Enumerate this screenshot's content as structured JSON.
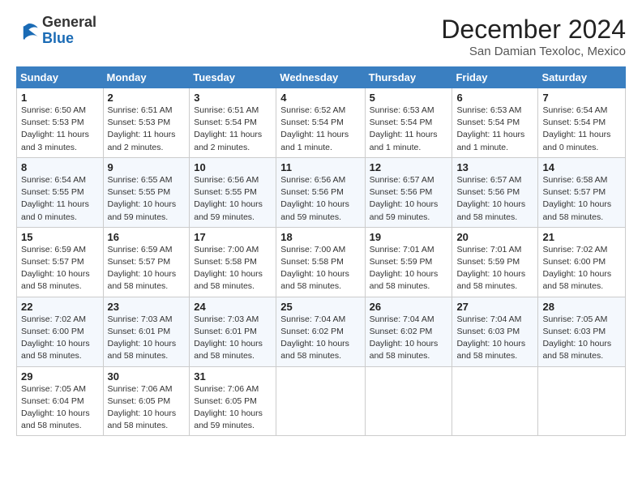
{
  "logo": {
    "general": "General",
    "blue": "Blue"
  },
  "title": "December 2024",
  "subtitle": "San Damian Texoloc, Mexico",
  "days_of_week": [
    "Sunday",
    "Monday",
    "Tuesday",
    "Wednesday",
    "Thursday",
    "Friday",
    "Saturday"
  ],
  "weeks": [
    [
      {
        "day": "1",
        "detail": "Sunrise: 6:50 AM\nSunset: 5:53 PM\nDaylight: 11 hours\nand 3 minutes."
      },
      {
        "day": "2",
        "detail": "Sunrise: 6:51 AM\nSunset: 5:53 PM\nDaylight: 11 hours\nand 2 minutes."
      },
      {
        "day": "3",
        "detail": "Sunrise: 6:51 AM\nSunset: 5:54 PM\nDaylight: 11 hours\nand 2 minutes."
      },
      {
        "day": "4",
        "detail": "Sunrise: 6:52 AM\nSunset: 5:54 PM\nDaylight: 11 hours\nand 1 minute."
      },
      {
        "day": "5",
        "detail": "Sunrise: 6:53 AM\nSunset: 5:54 PM\nDaylight: 11 hours\nand 1 minute."
      },
      {
        "day": "6",
        "detail": "Sunrise: 6:53 AM\nSunset: 5:54 PM\nDaylight: 11 hours\nand 1 minute."
      },
      {
        "day": "7",
        "detail": "Sunrise: 6:54 AM\nSunset: 5:54 PM\nDaylight: 11 hours\nand 0 minutes."
      }
    ],
    [
      {
        "day": "8",
        "detail": "Sunrise: 6:54 AM\nSunset: 5:55 PM\nDaylight: 11 hours\nand 0 minutes."
      },
      {
        "day": "9",
        "detail": "Sunrise: 6:55 AM\nSunset: 5:55 PM\nDaylight: 10 hours\nand 59 minutes."
      },
      {
        "day": "10",
        "detail": "Sunrise: 6:56 AM\nSunset: 5:55 PM\nDaylight: 10 hours\nand 59 minutes."
      },
      {
        "day": "11",
        "detail": "Sunrise: 6:56 AM\nSunset: 5:56 PM\nDaylight: 10 hours\nand 59 minutes."
      },
      {
        "day": "12",
        "detail": "Sunrise: 6:57 AM\nSunset: 5:56 PM\nDaylight: 10 hours\nand 59 minutes."
      },
      {
        "day": "13",
        "detail": "Sunrise: 6:57 AM\nSunset: 5:56 PM\nDaylight: 10 hours\nand 58 minutes."
      },
      {
        "day": "14",
        "detail": "Sunrise: 6:58 AM\nSunset: 5:57 PM\nDaylight: 10 hours\nand 58 minutes."
      }
    ],
    [
      {
        "day": "15",
        "detail": "Sunrise: 6:59 AM\nSunset: 5:57 PM\nDaylight: 10 hours\nand 58 minutes."
      },
      {
        "day": "16",
        "detail": "Sunrise: 6:59 AM\nSunset: 5:57 PM\nDaylight: 10 hours\nand 58 minutes."
      },
      {
        "day": "17",
        "detail": "Sunrise: 7:00 AM\nSunset: 5:58 PM\nDaylight: 10 hours\nand 58 minutes."
      },
      {
        "day": "18",
        "detail": "Sunrise: 7:00 AM\nSunset: 5:58 PM\nDaylight: 10 hours\nand 58 minutes."
      },
      {
        "day": "19",
        "detail": "Sunrise: 7:01 AM\nSunset: 5:59 PM\nDaylight: 10 hours\nand 58 minutes."
      },
      {
        "day": "20",
        "detail": "Sunrise: 7:01 AM\nSunset: 5:59 PM\nDaylight: 10 hours\nand 58 minutes."
      },
      {
        "day": "21",
        "detail": "Sunrise: 7:02 AM\nSunset: 6:00 PM\nDaylight: 10 hours\nand 58 minutes."
      }
    ],
    [
      {
        "day": "22",
        "detail": "Sunrise: 7:02 AM\nSunset: 6:00 PM\nDaylight: 10 hours\nand 58 minutes."
      },
      {
        "day": "23",
        "detail": "Sunrise: 7:03 AM\nSunset: 6:01 PM\nDaylight: 10 hours\nand 58 minutes."
      },
      {
        "day": "24",
        "detail": "Sunrise: 7:03 AM\nSunset: 6:01 PM\nDaylight: 10 hours\nand 58 minutes."
      },
      {
        "day": "25",
        "detail": "Sunrise: 7:04 AM\nSunset: 6:02 PM\nDaylight: 10 hours\nand 58 minutes."
      },
      {
        "day": "26",
        "detail": "Sunrise: 7:04 AM\nSunset: 6:02 PM\nDaylight: 10 hours\nand 58 minutes."
      },
      {
        "day": "27",
        "detail": "Sunrise: 7:04 AM\nSunset: 6:03 PM\nDaylight: 10 hours\nand 58 minutes."
      },
      {
        "day": "28",
        "detail": "Sunrise: 7:05 AM\nSunset: 6:03 PM\nDaylight: 10 hours\nand 58 minutes."
      }
    ],
    [
      {
        "day": "29",
        "detail": "Sunrise: 7:05 AM\nSunset: 6:04 PM\nDaylight: 10 hours\nand 58 minutes."
      },
      {
        "day": "30",
        "detail": "Sunrise: 7:06 AM\nSunset: 6:05 PM\nDaylight: 10 hours\nand 58 minutes."
      },
      {
        "day": "31",
        "detail": "Sunrise: 7:06 AM\nSunset: 6:05 PM\nDaylight: 10 hours\nand 59 minutes."
      },
      null,
      null,
      null,
      null
    ]
  ]
}
